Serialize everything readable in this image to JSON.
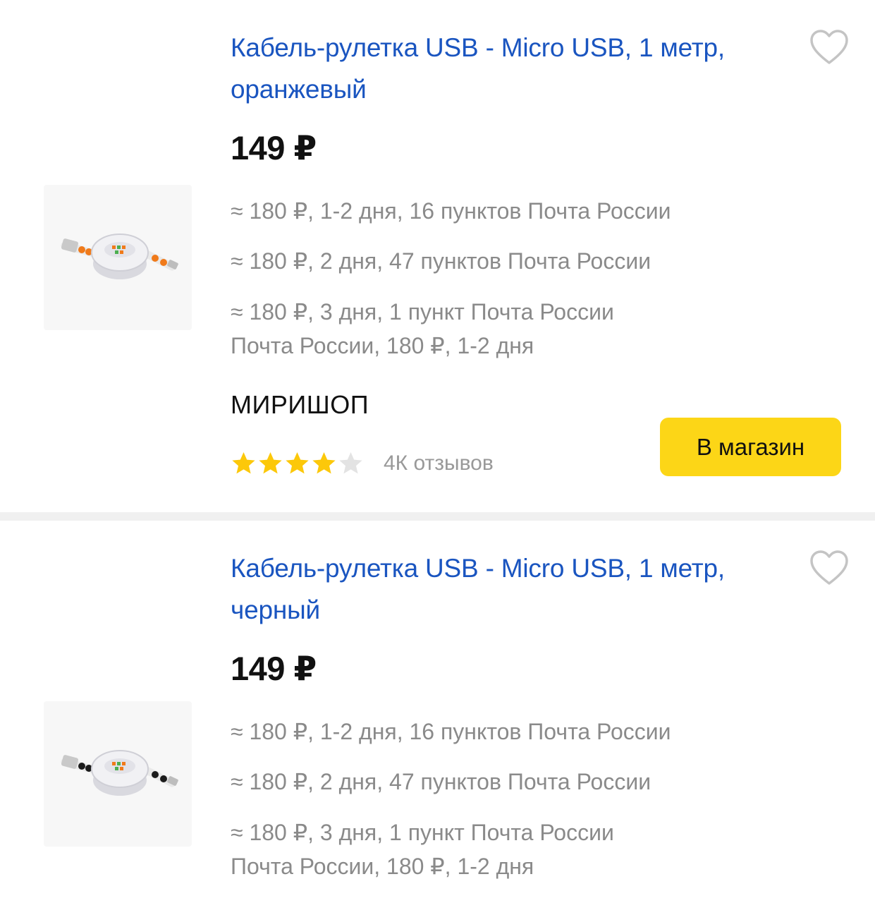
{
  "products": [
    {
      "title": "Кабель-рулетка USB - Micro USB, 1 метр, оранжевый",
      "price": "149 ₽",
      "delivery": [
        "≈ 180 ₽, 1-2 дня, 16 пунктов Почта России",
        "≈ 180 ₽, 2 дня, 47 пунктов Почта России",
        "≈ 180 ₽, 3 дня, 1 пункт Почта России",
        "Почта России, 180 ₽, 1-2 дня"
      ],
      "shop": "МИРИШОП",
      "rating": 4,
      "rating_max": 5,
      "reviews": "4К отзывов",
      "button": "В магазин",
      "accent_color": "#f07a1a"
    },
    {
      "title": "Кабель-рулетка USB - Micro USB, 1 метр, черный",
      "price": "149 ₽",
      "delivery": [
        "≈ 180 ₽, 1-2 дня, 16 пунктов Почта России",
        "≈ 180 ₽, 2 дня, 47 пунктов Почта России",
        "≈ 180 ₽, 3 дня, 1 пункт Почта России",
        "Почта России, 180 ₽, 1-2 дня"
      ],
      "accent_color": "#1b1b1b"
    }
  ],
  "colors": {
    "link": "#1a55c0",
    "button": "#fcd617",
    "star_filled": "#fcc80a",
    "star_empty": "#e3e3e3",
    "muted_text": "#8a8a8a"
  },
  "icons": {
    "favorite": "heart-outline-icon",
    "rating": "star-icon",
    "product_image": "retractable-cable-image"
  }
}
